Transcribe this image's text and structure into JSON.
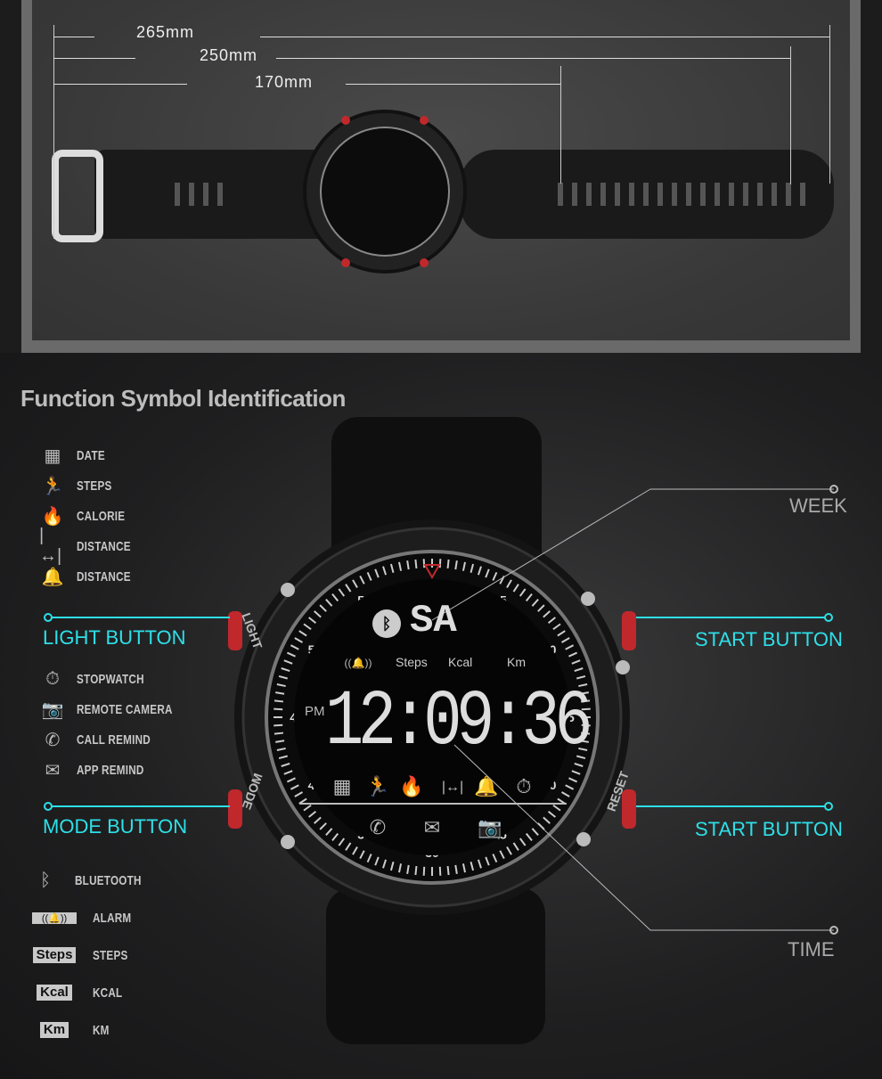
{
  "dimensions": {
    "length_total": "265mm",
    "length_mid": "250mm",
    "length_short": "170mm"
  },
  "heading": "Function Symbol Identification",
  "legend_top": [
    {
      "icon": "calendar-icon",
      "glyph": "▦",
      "label": "DATE"
    },
    {
      "icon": "runner-icon",
      "glyph": "🏃",
      "label": "STEPS"
    },
    {
      "icon": "flame-icon",
      "glyph": "🔥",
      "label": "CALORIE"
    },
    {
      "icon": "distance-icon",
      "glyph": "|↔|",
      "label": "DISTANCE"
    },
    {
      "icon": "bell-icon",
      "glyph": "🔔",
      "label": "DISTANCE"
    }
  ],
  "legend_mid": [
    {
      "icon": "stopwatch-icon",
      "glyph": "⏱",
      "label": "STOPWATCH"
    },
    {
      "icon": "camera-icon",
      "glyph": "📷",
      "label": "REMOTE CAMERA"
    },
    {
      "icon": "phone-icon",
      "glyph": "✆",
      "label": "CALL REMIND"
    },
    {
      "icon": "envelope-icon",
      "glyph": "✉",
      "label": "APP REMIND"
    }
  ],
  "legend_bottom": [
    {
      "icon": "bluetooth-icon",
      "glyph": "ᛒ",
      "label": "BLUETOOTH"
    },
    {
      "icon": "alarm-badge-icon",
      "glyph": "((🔔))",
      "label": "ALARM"
    },
    {
      "icon": "steps-badge",
      "glyph": "Steps",
      "label": "STEPS"
    },
    {
      "icon": "kcal-badge",
      "glyph": "Kcal",
      "label": "KCAL"
    },
    {
      "icon": "km-badge",
      "glyph": "Km",
      "label": "KM"
    }
  ],
  "callouts": {
    "light": "LIGHT BUTTON",
    "mode": "MODE BUTTON",
    "start_top": "START BUTTON",
    "start_bottom": "START BUTTON",
    "week": "WEEK",
    "time": "TIME"
  },
  "colors": {
    "accent": "#2de0e8",
    "button_red": "#c0282c"
  },
  "watch": {
    "week": "SA",
    "time": "12:09:36",
    "ampm": "PM",
    "steps": "Steps",
    "kcal": "Kcal",
    "km": "Km",
    "light": "LIGHT",
    "mode": "MODE",
    "reset": "RESET",
    "dial": [
      "05",
      "10",
      "15",
      "20",
      "25",
      "30",
      "35",
      "40",
      "45",
      "50",
      "55"
    ]
  }
}
